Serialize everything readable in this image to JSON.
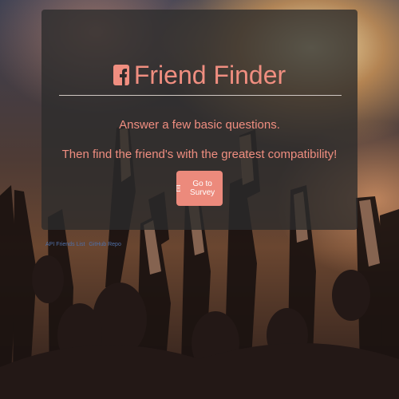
{
  "header": {
    "title": "Friend Finder",
    "icon": "facebook-icon"
  },
  "intro": {
    "line1": "Answer a few basic questions.",
    "line2": "Then find the friend's with the greatest compatibility!"
  },
  "cta": {
    "label": "Go to Survey",
    "icon": "list-icon"
  },
  "footer": {
    "links": [
      {
        "label": "API Friends List"
      },
      {
        "label": "GitHub Repo"
      }
    ]
  },
  "colors": {
    "accent": "#f08e80",
    "button": "#ec8a7c",
    "panel": "#2c2c2c",
    "link": "#4f70a8"
  }
}
